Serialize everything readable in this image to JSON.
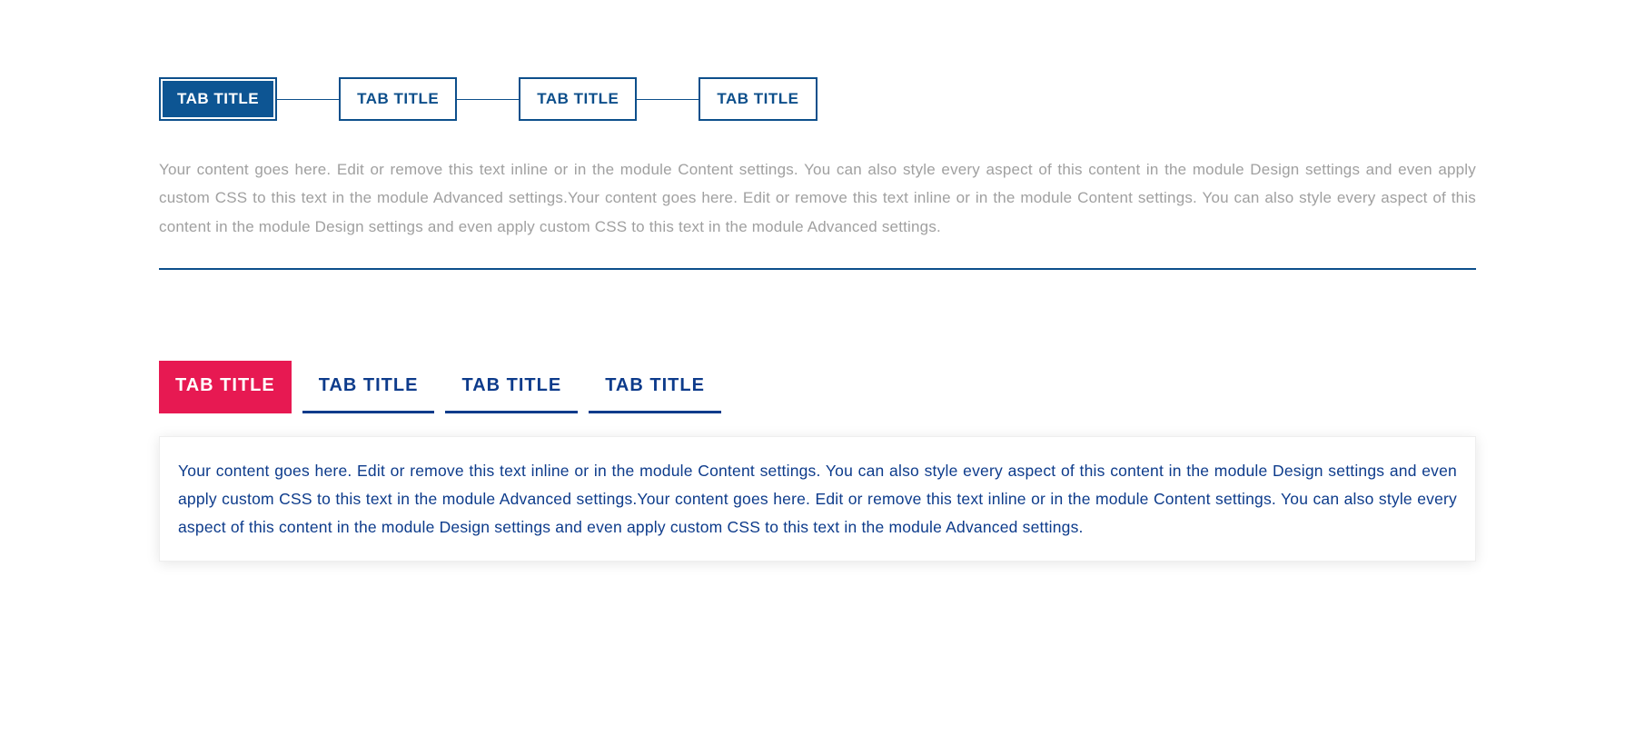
{
  "section1": {
    "tabs": [
      {
        "label": "TAB TITLE",
        "active": true
      },
      {
        "label": "TAB TITLE",
        "active": false
      },
      {
        "label": "TAB TITLE",
        "active": false
      },
      {
        "label": "TAB TITLE",
        "active": false
      }
    ],
    "content": "Your content goes here. Edit or remove this text inline or in the module Content settings. You can also style every aspect of this content in the module Design settings and even apply custom CSS to this text in the module Advanced settings.Your content goes here. Edit or remove this text inline or in the module Content settings. You can also style every aspect of this content in the module Design settings and even apply custom CSS to this text in the module Advanced settings."
  },
  "section2": {
    "tabs": [
      {
        "label": "TAB TITLE",
        "active": true
      },
      {
        "label": "TAB TITLE",
        "active": false
      },
      {
        "label": "TAB TITLE",
        "active": false
      },
      {
        "label": "TAB TITLE",
        "active": false
      }
    ],
    "content": "Your content goes here. Edit or remove this text inline or in the module Content settings. You can also style every aspect of this content in the module Design settings and even apply custom CSS to this text in the module Advanced settings.Your content goes here. Edit or remove this text inline or in the module Content settings. You can also style every aspect of this content in the module Design settings and even apply custom CSS to this text in the module Advanced settings."
  },
  "colors": {
    "primary_blue": "#0d4f8b",
    "dark_blue_text": "#0d3b8b",
    "accent_pink": "#e71952",
    "muted_grey": "#a0a0a0"
  }
}
